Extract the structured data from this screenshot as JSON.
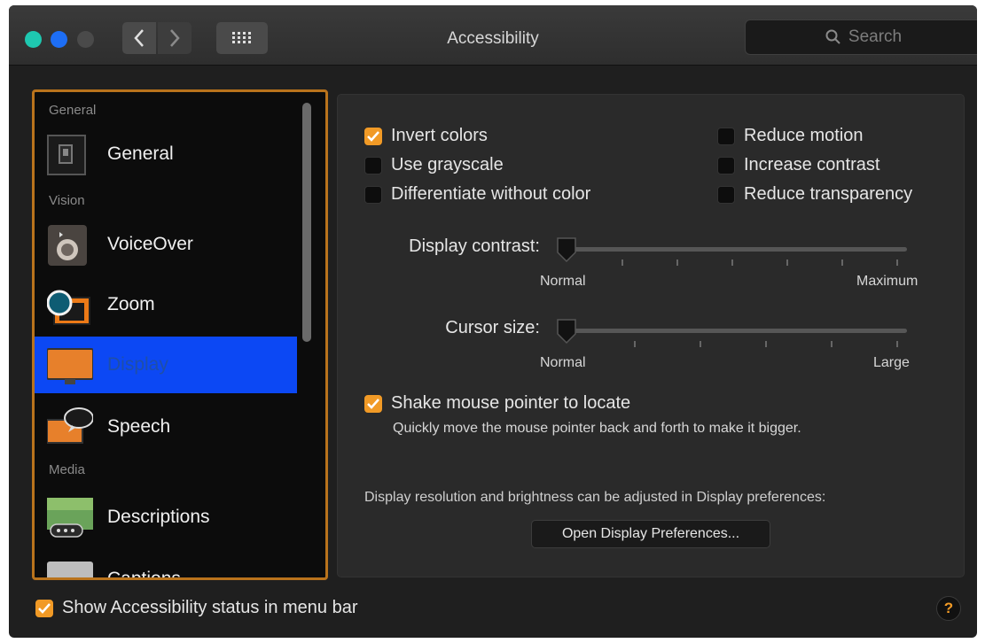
{
  "window": {
    "title": "Accessibility",
    "search_placeholder": "Search"
  },
  "sidebar": {
    "sections": [
      {
        "label": "General"
      },
      {
        "label": "Vision"
      },
      {
        "label": "Media"
      }
    ],
    "items": [
      {
        "label": "General",
        "icon": "switch-icon"
      },
      {
        "label": "VoiceOver",
        "icon": "voiceover-icon"
      },
      {
        "label": "Zoom",
        "icon": "zoom-icon"
      },
      {
        "label": "Display",
        "icon": "display-icon",
        "selected": true
      },
      {
        "label": "Speech",
        "icon": "speech-icon"
      },
      {
        "label": "Descriptions",
        "icon": "descriptions-icon"
      },
      {
        "label": "Captions",
        "icon": "captions-icon"
      }
    ]
  },
  "options": {
    "invert_colors": {
      "label": "Invert colors",
      "checked": true
    },
    "use_grayscale": {
      "label": "Use grayscale",
      "checked": false
    },
    "differentiate": {
      "label": "Differentiate without color",
      "checked": false
    },
    "reduce_motion": {
      "label": "Reduce motion",
      "checked": false
    },
    "increase_contrast": {
      "label": "Increase contrast",
      "checked": false
    },
    "reduce_transparency": {
      "label": "Reduce transparency",
      "checked": false
    }
  },
  "sliders": {
    "display_contrast": {
      "label": "Display contrast:",
      "min_label": "Normal",
      "max_label": "Maximum",
      "value": 0
    },
    "cursor_size": {
      "label": "Cursor size:",
      "min_label": "Normal",
      "max_label": "Large",
      "value": 0
    }
  },
  "shake": {
    "label": "Shake mouse pointer to locate",
    "checked": true,
    "hint": "Quickly move the mouse pointer back and forth to make it bigger."
  },
  "display_prefs": {
    "note": "Display resolution and brightness can be adjusted in Display preferences:",
    "button_label": "Open Display Preferences..."
  },
  "footer": {
    "status_label": "Show Accessibility status in menu bar",
    "status_checked": true,
    "help_label": "?"
  },
  "colors": {
    "accent": "#f19a26",
    "selection": "#0c48f4",
    "sidebar_border": "#b9731c"
  }
}
